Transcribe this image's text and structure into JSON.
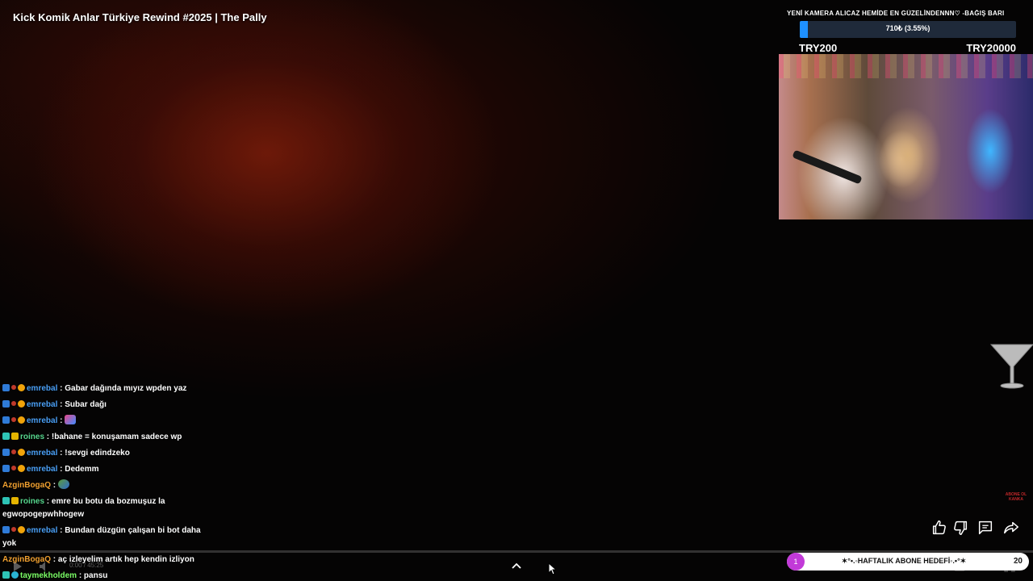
{
  "video": {
    "title": "Kick Komik Anlar Türkiye Rewind #2025 | The Pally"
  },
  "donation_goal": {
    "title": "YENİ KAMERA ALICAZ HEMİDE EN GÜZELİNDENNN♡ -BAĞIŞ BARI",
    "progress_text": "710₺ (3.55%)",
    "progress_percent": 3.55,
    "min_label": "TRY200",
    "max_label": "TRY20000",
    "bar_color": "#1e90ff"
  },
  "chat": {
    "messages": [
      {
        "user": "emrebal",
        "text": ": Gabar dağında mıyız wpden yaz",
        "badges": [
          "blue",
          "red",
          "gold"
        ],
        "color": "blue"
      },
      {
        "user": "emrebal",
        "text": ": Subar dağı",
        "badges": [
          "blue",
          "red",
          "gold"
        ],
        "color": "blue"
      },
      {
        "user": "emrebal",
        "text": ":",
        "badges": [
          "blue",
          "red",
          "gold"
        ],
        "color": "blue",
        "emote": "emote-a"
      },
      {
        "user": "roines",
        "text": ": !bahane = konuşamam sadece wp",
        "badges": [
          "gem",
          "yellow"
        ],
        "color": "green"
      },
      {
        "user": "emrebal",
        "text": ": !sevgi edindzeko",
        "badges": [
          "blue",
          "red",
          "gold"
        ],
        "color": "blue"
      },
      {
        "user": "emrebal",
        "text": ": Dedemm",
        "badges": [
          "blue",
          "red",
          "gold"
        ],
        "color": "blue"
      },
      {
        "user": "AzginBogaQ",
        "text": ":",
        "badges": [],
        "color": "orange",
        "emote": "emote-b"
      },
      {
        "user": "roines",
        "text": ": emre bu botu da bozmuşuz la egwopogepwhhogew",
        "badges": [
          "gem",
          "yellow"
        ],
        "color": "green"
      },
      {
        "user": "emrebal",
        "text": ": Bundan düzgün çalışan bi bot daha yok",
        "badges": [
          "blue",
          "red",
          "gold"
        ],
        "color": "blue"
      },
      {
        "user": "AzginBogaQ",
        "text": ": aç izleyelim artık hep kendin izliyon",
        "badges": [],
        "color": "orange"
      },
      {
        "user": "taymekholdem",
        "text": ": pansu",
        "badges": [
          "gem",
          "cyan"
        ],
        "color": "lime"
      }
    ]
  },
  "watermark": {
    "text": "ABONE OL KANKA"
  },
  "actions": {
    "like": "thumbs-up-icon",
    "dislike": "thumbs-down-icon",
    "comments": "comment-icon",
    "share": "share-icon"
  },
  "sub_goal": {
    "icon_text": "1",
    "text": "✶°•.◦HAFTALIK ABONE HEDEFİ◦.•°✶",
    "count": "20"
  },
  "player": {
    "time_label": "0:00 / 45:25",
    "expand_icon": "chevron-up-icon"
  }
}
